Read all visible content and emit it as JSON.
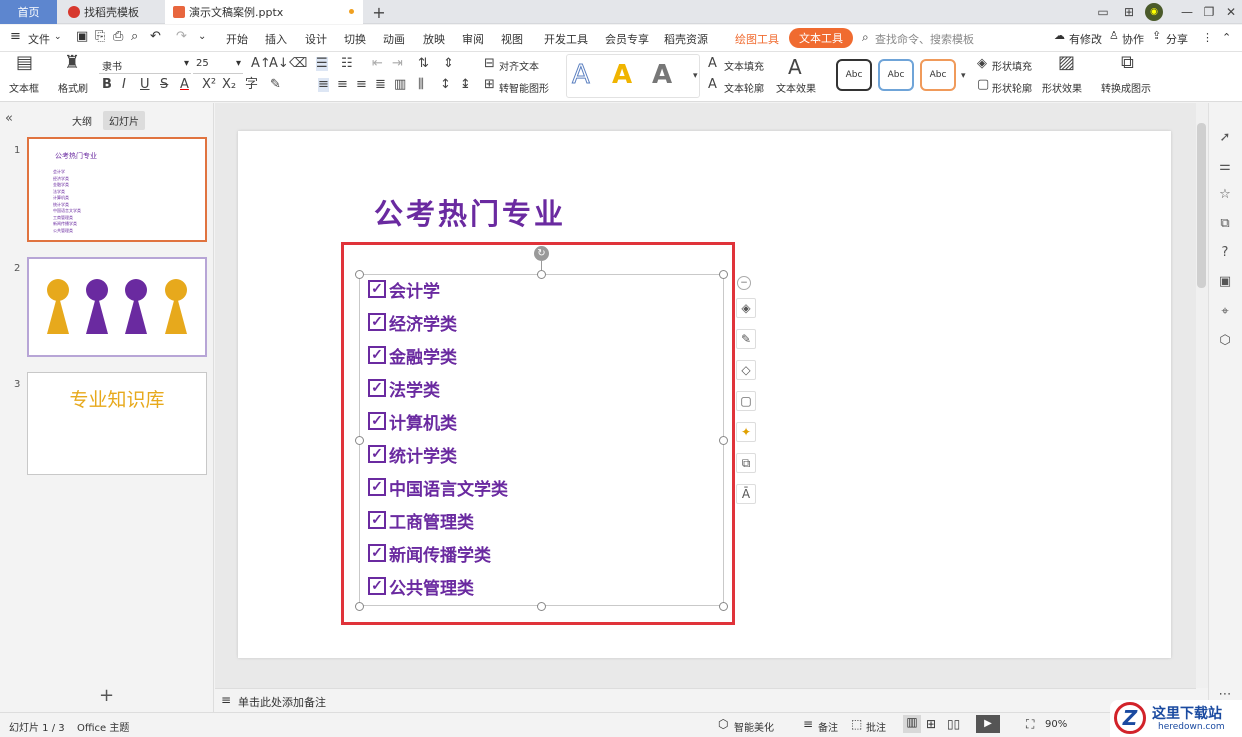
{
  "tabs": {
    "home": "首页",
    "template": "找稻壳模板",
    "file": "演示文稿案例.pptx",
    "new_tab": "+"
  },
  "menu": {
    "file": "文件",
    "items": [
      "开始",
      "插入",
      "设计",
      "切换",
      "动画",
      "放映",
      "审阅",
      "视图",
      "开发工具",
      "会员专享",
      "稻壳资源"
    ],
    "drawing_tools": "绘图工具",
    "text_tools": "文本工具",
    "search_placeholder": "查找命令、搜索模板",
    "has_changes": "有修改",
    "collaborate": "协作",
    "share": "分享"
  },
  "ribbon": {
    "textbox": "文本框",
    "format_painter": "格式刷",
    "font_name": "隶书",
    "font_size": "25",
    "align_text": "对齐文本",
    "smart_shape": "转智能图形",
    "text_fill": "文本填充",
    "text_outline": "文本轮廓",
    "text_effect": "文本效果",
    "shape_fill": "形状填充",
    "shape_outline": "形状轮廓",
    "shape_effect": "形状效果",
    "convert_diagram": "转换成图示",
    "abc": "Abc"
  },
  "panel": {
    "outline_tab": "大纲",
    "slides_tab": "幻灯片",
    "add": "+"
  },
  "thumbs": {
    "n1": "1",
    "n2": "2",
    "n3": "3",
    "t1_title": "公考热门专业",
    "t3_title": "专业知识库"
  },
  "slide": {
    "title": "公考热门专业",
    "items": [
      "会计学",
      "经济学类",
      "金融学类",
      "法学类",
      "计算机类",
      "统计学类",
      "中国语言文学类",
      "工商管理类",
      "新闻传播学类",
      "公共管理类"
    ]
  },
  "notes": {
    "placeholder": "单击此处添加备注"
  },
  "status": {
    "slide_count": "幻灯片 1 / 3",
    "theme": "Office 主题",
    "beautify": "智能美化",
    "remarks": "备注",
    "comments": "批注",
    "zoom": "90%",
    "watermark": "这里下载站",
    "watermark_url": "heredown.com"
  },
  "colors": {
    "accent_purple": "#6a2aa0",
    "accent_orange": "#f06b30",
    "selection_red": "#e0333a",
    "thumb_orange": "#e7a91c"
  }
}
